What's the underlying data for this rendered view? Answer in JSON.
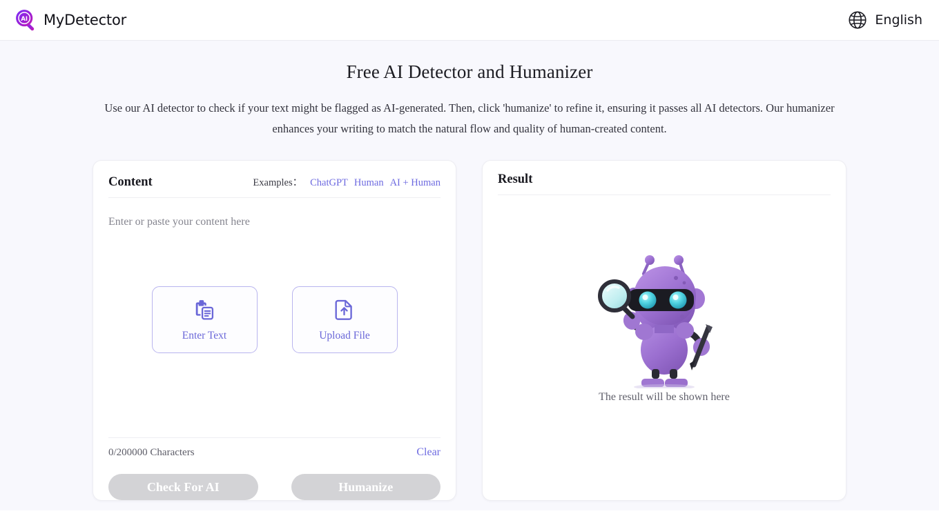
{
  "header": {
    "brand_name": "MyDetector",
    "logo_icon": "ai-magnifier-logo",
    "language_icon": "globe-icon",
    "language_label": "English"
  },
  "hero": {
    "title": "Free AI Detector and Humanizer",
    "description": "Use our AI detector to check if your text might be flagged as AI-generated. Then, click 'humanize' to refine it, ensuring it passes all AI detectors. Our humanizer enhances your writing to match the natural flow and quality of human-created content."
  },
  "content_panel": {
    "title": "Content",
    "examples_label": "Examples：",
    "examples": [
      {
        "label": "ChatGPT"
      },
      {
        "label": "Human"
      },
      {
        "label": "AI + Human"
      }
    ],
    "textarea_placeholder": "Enter or paste your content here",
    "textarea_value": "",
    "actions": [
      {
        "label": "Enter Text",
        "icon": "paste-clipboard-icon"
      },
      {
        "label": "Upload File",
        "icon": "file-upload-icon"
      }
    ],
    "char_count": "0/200000 Characters",
    "clear_label": "Clear",
    "buttons": [
      {
        "label": "Check For AI",
        "disabled": true
      },
      {
        "label": "Humanize",
        "disabled": true
      }
    ]
  },
  "result_panel": {
    "title": "Result",
    "illustration": "robot-mascot-with-magnifier-and-pen",
    "empty_message": "The result will be shown here"
  },
  "colors": {
    "accent_purple": "#6d6ae0",
    "page_background": "#f8f8fd",
    "panel_background": "#ffffff",
    "disabled_button": "#d3d3d6",
    "robot_purple": "#9b6fd0",
    "robot_eye_cyan": "#54d8e0"
  }
}
